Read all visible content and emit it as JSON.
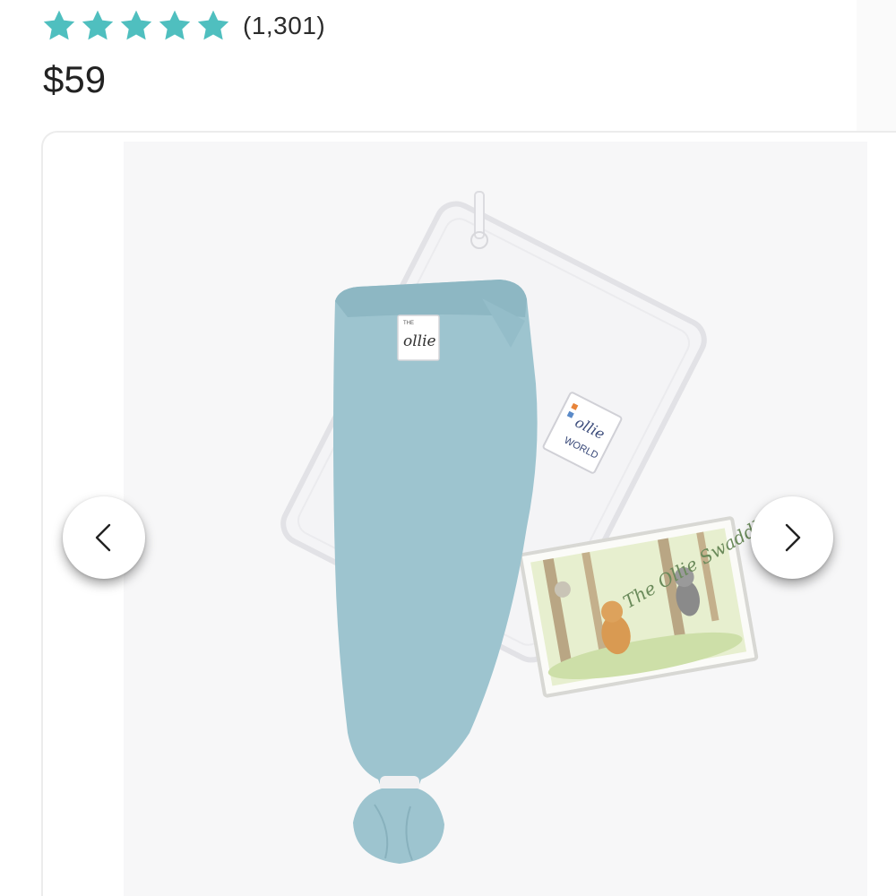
{
  "rating": {
    "stars": 5,
    "star_color": "#4fbfbf",
    "review_count": "(1,301)"
  },
  "price": "$59",
  "gallery": {
    "product_labels": {
      "swaddle_tag": "ollie",
      "swaddle_tag_prefix": "THE",
      "blanket_tag": "ollie",
      "blanket_tag_sub": "WORLD",
      "book_title": "The Ollie Swaddle"
    },
    "prev_icon": "chevron-left-icon",
    "next_icon": "chevron-right-icon",
    "colors": {
      "swaddle": "#9dc4cf",
      "blanket": "#f3f3f5",
      "background": "#f7f7f8"
    }
  }
}
